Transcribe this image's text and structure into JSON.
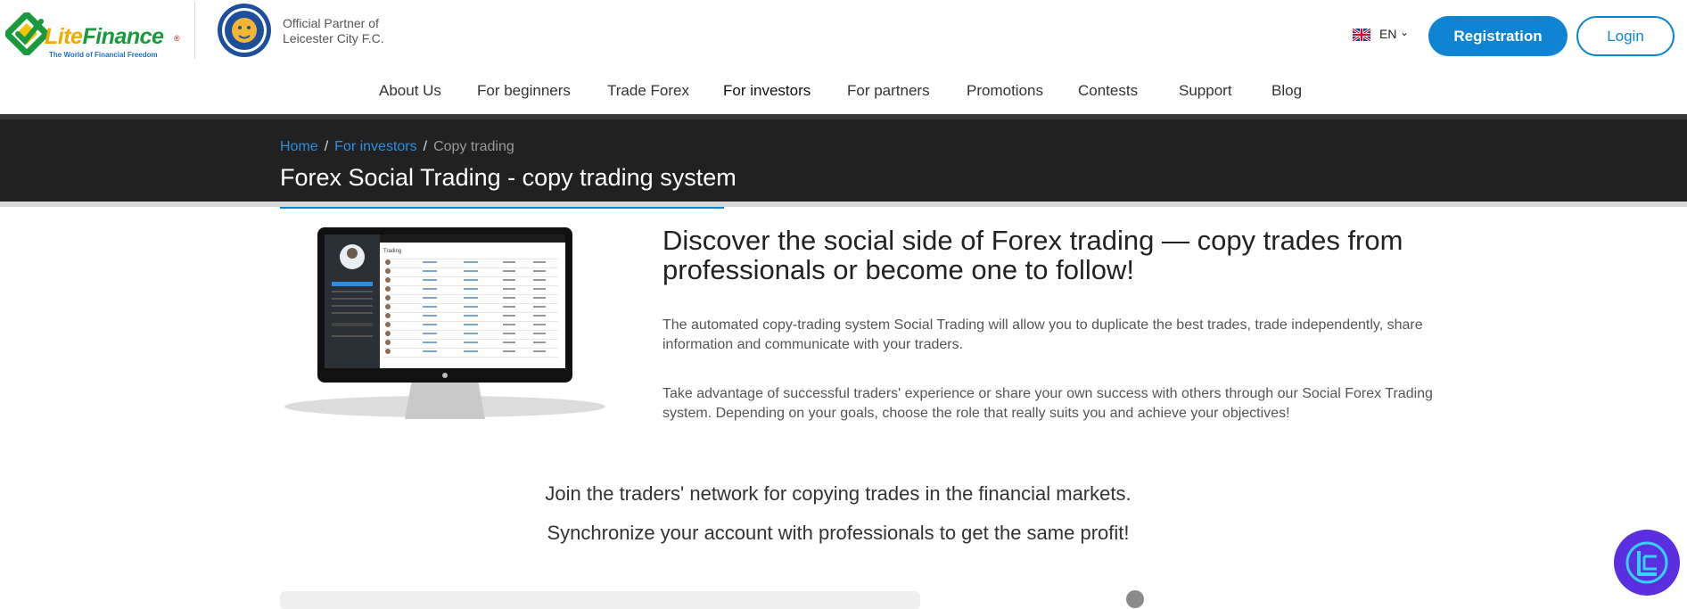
{
  "brand": {
    "name_part1": "Lite",
    "name_part2": "Finance",
    "tagline": "The World of Financial Freedom",
    "registered_mark": "®"
  },
  "partner": {
    "line1": "Official Partner of",
    "line2": "Leicester City F.C.",
    "badge_icon": "leicester-city-crest"
  },
  "header": {
    "language": "EN",
    "flag_icon": "uk-flag",
    "registration_label": "Registration",
    "login_label": "Login"
  },
  "nav": {
    "items": [
      {
        "label": "About Us"
      },
      {
        "label": "For beginners"
      },
      {
        "label": "Trade Forex"
      },
      {
        "label": "For investors",
        "active": true
      },
      {
        "label": "For partners"
      },
      {
        "label": "Promotions"
      },
      {
        "label": "Contests"
      },
      {
        "label": "Support"
      },
      {
        "label": "Blog"
      }
    ]
  },
  "breadcrumb": {
    "items": [
      "Home",
      "For investors",
      "Copy trading"
    ],
    "separator": "/"
  },
  "page": {
    "title": "Forex Social Trading - copy trading system"
  },
  "intro": {
    "headline": "Discover the social side of Forex trading — copy trades from professionals or become one to follow!",
    "paragraph1": "The automated copy-trading system Social Trading will allow you to duplicate the best trades, trade independently, share information and communicate with your traders.",
    "paragraph2": "Take advantage of successful traders' experience or share your own success with others through our Social Forex Trading system. Depending on your goals, choose the role that really suits you and achieve your objectives!"
  },
  "join": {
    "line1": "Join the traders' network for copying trades in the financial markets.",
    "line2": "Synchronize your account with professionals to get the same profit!"
  },
  "monitor": {
    "screen_label": "Trading"
  },
  "colors": {
    "accent": "#0f84d3",
    "banner_bg": "#212121",
    "brand_green": "#1a9a3c",
    "fab": "#5b2ee0"
  },
  "fab_icon": "chat-widget-icon"
}
